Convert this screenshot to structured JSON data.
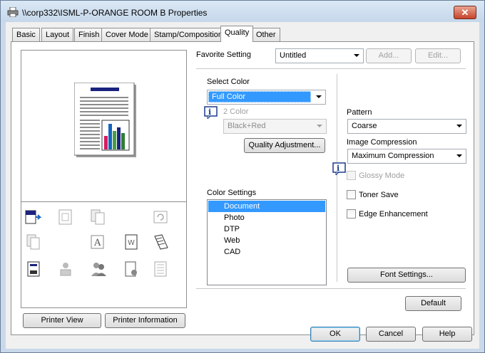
{
  "window": {
    "title": "\\\\corp332\\ISML-P-ORANGE ROOM B Properties",
    "close_label": "✕"
  },
  "tabs": [
    "Basic",
    "Layout",
    "Finish",
    "Cover Mode",
    "Stamp/Composition",
    "Quality",
    "Other"
  ],
  "active_tab": "Quality",
  "favorite": {
    "label": "Favorite Setting",
    "value": "Untitled",
    "add_label": "Add...",
    "edit_label": "Edit..."
  },
  "select_color": {
    "label": "Select Color",
    "value": "Full Color"
  },
  "two_color": {
    "label": "2 Color",
    "value": "Black+Red"
  },
  "quality_adjustment_label": "Quality Adjustment...",
  "color_settings": {
    "label": "Color Settings",
    "items": [
      "Document",
      "Photo",
      "DTP",
      "Web",
      "CAD"
    ],
    "selected": "Document"
  },
  "pattern": {
    "label": "Pattern",
    "value": "Coarse"
  },
  "image_compression": {
    "label": "Image Compression",
    "value": "Maximum Compression"
  },
  "checkboxes": {
    "glossy_mode": "Glossy Mode",
    "toner_save": "Toner Save",
    "edge_enhancement": "Edge Enhancement"
  },
  "font_settings_label": "Font Settings...",
  "default_label": "Default",
  "printer_view_label": "Printer View",
  "printer_information_label": "Printer Information",
  "footer": {
    "ok": "OK",
    "cancel": "Cancel",
    "help": "Help"
  },
  "colors": {
    "selection": "#3399ff",
    "title_bar": "#c9d9ea",
    "close": "#c7432b",
    "preview_title_bar": "#1a237e"
  }
}
